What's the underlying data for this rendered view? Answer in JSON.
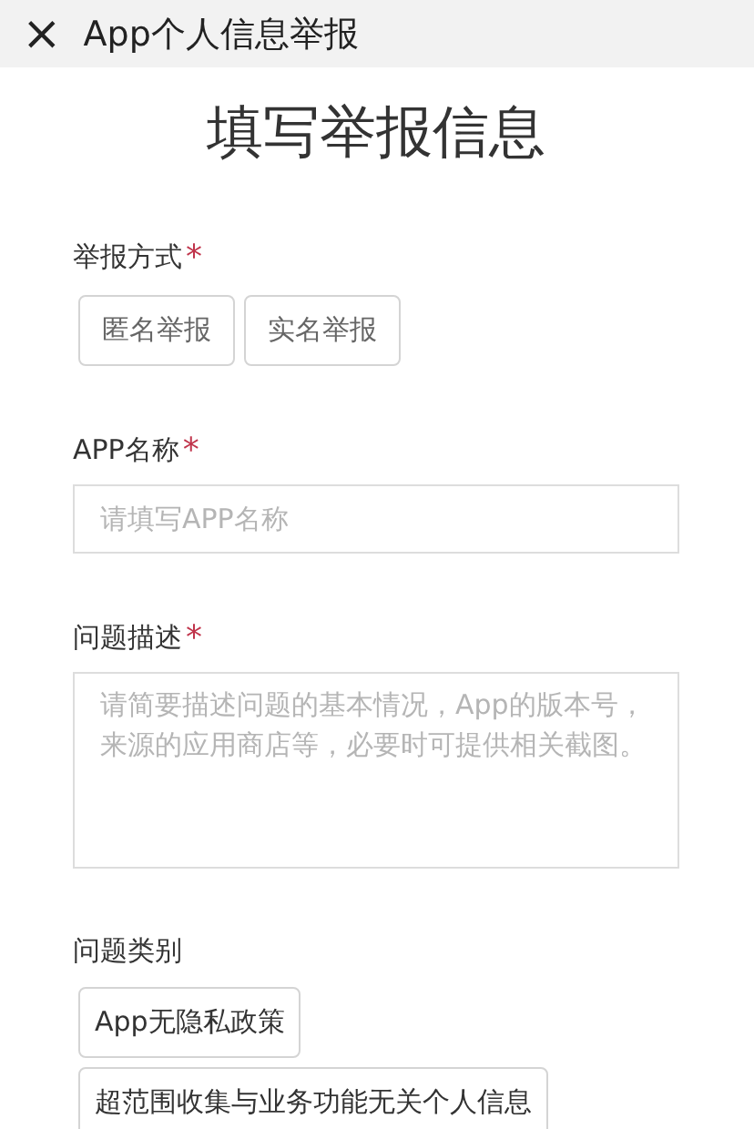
{
  "top_bar": {
    "close_icon": "×",
    "title": "App个人信息举报"
  },
  "heading": "填写举报信息",
  "report_method": {
    "label": "举报方式",
    "required_mark": "*",
    "options": [
      {
        "label": "匿名举报",
        "selected": false
      },
      {
        "label": "实名举报",
        "selected": false
      }
    ]
  },
  "app_name": {
    "label": "APP名称",
    "required_mark": "*",
    "placeholder": "请填写APP名称"
  },
  "description": {
    "label": "问题描述",
    "required_mark": "*",
    "placeholder": "请简要描述问题的基本情况，App的版本号，来源的应用商店等，必要时可提供相关截图。"
  },
  "category": {
    "label": "问题类别",
    "options": [
      {
        "label": "App无隐私政策",
        "selected": false
      },
      {
        "label": "超范围收集与业务功能无关个人信息",
        "selected": false
      }
    ]
  }
}
